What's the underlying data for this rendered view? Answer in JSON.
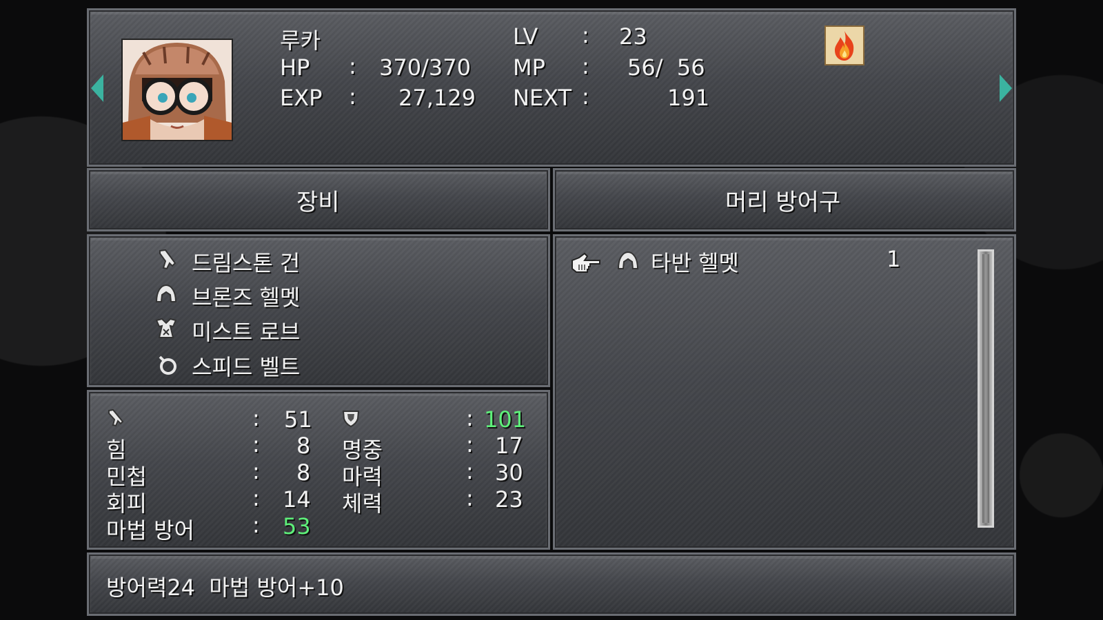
{
  "character": {
    "name": "루카",
    "lv_label": "LV",
    "lv_value": "23",
    "hp_label": "HP",
    "hp_value": "370/370",
    "mp_label": "MP",
    "mp_value": "56/  56",
    "exp_label": "EXP",
    "exp_value": "27,129",
    "next_label": "NEXT",
    "next_value": "191",
    "colon": ":",
    "element_icon": "fire-icon"
  },
  "tabs": {
    "equip_label": "장비",
    "category_label": "머리 방어구"
  },
  "equipped": [
    {
      "icon": "gun-icon",
      "name": "드림스톤 건"
    },
    {
      "icon": "helmet-icon",
      "name": "브론즈 헬멧"
    },
    {
      "icon": "armor-icon",
      "name": "미스트 로브"
    },
    {
      "icon": "accessory-icon",
      "name": "스피드 벨트"
    }
  ],
  "stats": {
    "left": [
      {
        "label": "",
        "icon": "attack-icon",
        "value": "51"
      },
      {
        "label": "힘",
        "value": "8"
      },
      {
        "label": "민첩",
        "value": "8"
      },
      {
        "label": "회피",
        "value": "14"
      },
      {
        "label": "마법 방어",
        "value": "53",
        "highlight": true
      }
    ],
    "right": [
      {
        "label": "",
        "icon": "defense-icon",
        "value": "101",
        "highlight": true
      },
      {
        "label": "명중",
        "value": "17"
      },
      {
        "label": "마력",
        "value": "30"
      },
      {
        "label": "체력",
        "value": "23"
      }
    ]
  },
  "inventory": [
    {
      "icon": "helmet-icon",
      "name": "타반 헬멧",
      "count": "1"
    }
  ],
  "description": "방어력24  마법 방어+10",
  "colors": {
    "highlight_green": "#5ef07a",
    "arrow_teal": "#3bb3a0"
  }
}
